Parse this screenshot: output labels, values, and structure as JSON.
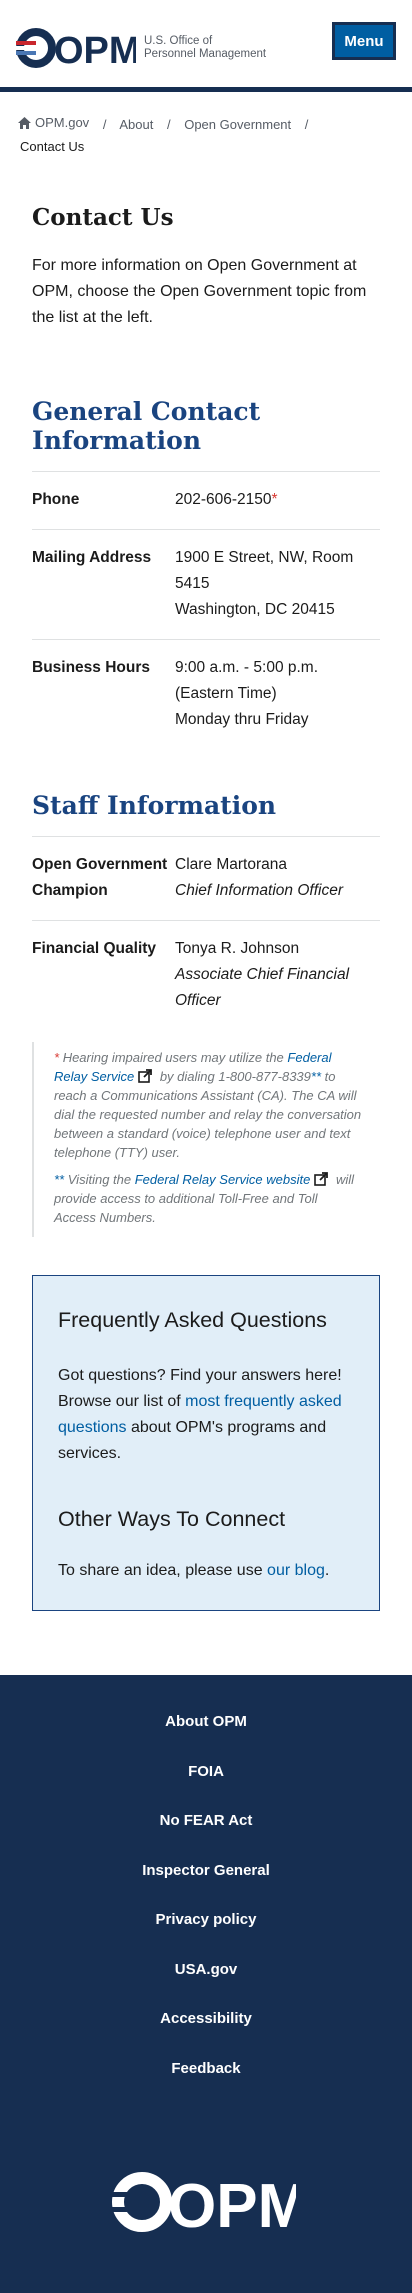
{
  "header": {
    "logo_text": "OPM",
    "org_line1": "U.S. Office of",
    "org_line2": "Personnel Management",
    "menu_label": "Menu"
  },
  "breadcrumb": {
    "items": [
      "OPM.gov",
      "About",
      "Open Government"
    ],
    "current": "Contact Us",
    "separator": "/"
  },
  "page": {
    "title": "Contact Us",
    "intro": "For more information on Open Government at OPM, choose the Open Government topic from the list at the left."
  },
  "general_contact": {
    "title": "General Contact Information",
    "phone_label": "Phone",
    "phone_value": "202-606-2150",
    "phone_marker": "*",
    "mailing_label": "Mailing Address",
    "mailing_line1": "1900 E Street, NW, Room 5415",
    "mailing_line2": "Washington, DC 20415",
    "hours_label": "Business Hours",
    "hours_line1": "9:00 a.m. - 5:00 p.m. (Eastern Time)",
    "hours_line2": "Monday thru Friday"
  },
  "staff": {
    "title": "Staff Information",
    "rows": [
      {
        "label": "Open Government Champion",
        "name": "Clare Martorana",
        "role": "Chief Information Officer"
      },
      {
        "label": "Financial Quality",
        "name": "Tonya R. Johnson",
        "role": "Associate Chief Financial Officer"
      }
    ]
  },
  "footnotes": {
    "note1_marker": "*",
    "note1_pre": "Hearing impaired users may utilize the",
    "note1_link": "Federal Relay Service",
    "note1_mid": "by dialing 1-800-877-8339",
    "note1_marker2": "**",
    "note1_post": "to reach a Communications Assistant (CA). The CA will dial the requested number and relay the conversation between a standard (voice) telephone user and text telephone (TTY) user.",
    "note2_marker": "**",
    "note2_pre": "Visiting the",
    "note2_link": "Federal Relay Service website",
    "note2_post": "will provide access to additional Toll-Free and Toll Access Numbers."
  },
  "faq": {
    "title": "Frequently Asked Questions",
    "text_pre": "Got questions? Find your answers here! Browse our list of",
    "text_link": "most frequently asked questions",
    "text_post": "about OPM's programs and services.",
    "connect_title": "Other Ways To Connect",
    "connect_pre": "To share an idea, please use",
    "connect_link": "our blog",
    "connect_post": "."
  },
  "footer": {
    "links": [
      "About OPM",
      "FOIA",
      "No FEAR Act",
      "Inspector General",
      "Privacy policy",
      "USA.gov",
      "Accessibility",
      "Feedback"
    ],
    "logo_text": "OPM"
  },
  "colors": {
    "navy": "#162e51",
    "primary_blue": "#005ea2",
    "heading_blue": "#1a4480",
    "footnote_red": "#d83933",
    "faq_bg": "#e1eef8"
  },
  "icons": [
    "home-icon",
    "external-link-icon",
    "opm-logo-icon"
  ]
}
